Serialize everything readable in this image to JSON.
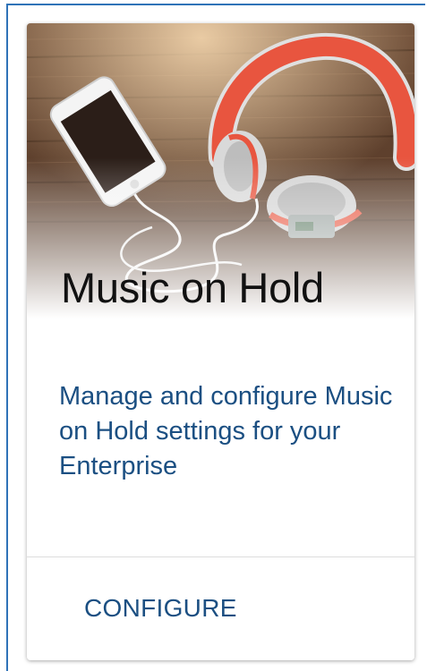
{
  "card": {
    "title": "Music on Hold",
    "description": "Manage and configure Music on Hold settings for your Enterprise",
    "action_label": "CONFIGURE",
    "image_icon": "headphones-phone-photo"
  },
  "colors": {
    "accent": "#1b4f82",
    "frame": "#2f73b8",
    "headphone_red": "#e8553f"
  }
}
